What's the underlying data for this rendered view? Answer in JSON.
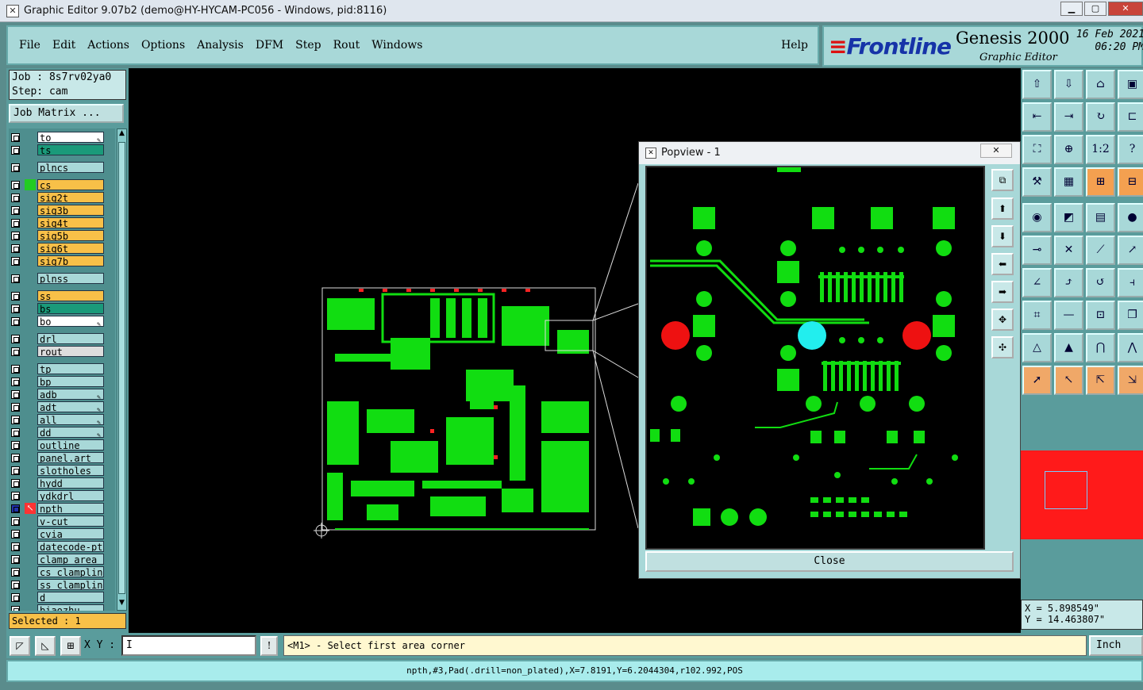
{
  "window": {
    "title": "Graphic Editor 9.07b2 (demo@HY-HYCAM-PC056 - Windows, pid:8116)"
  },
  "menu": {
    "items": [
      "File",
      "Edit",
      "Actions",
      "Options",
      "Analysis",
      "DFM",
      "Step",
      "Rout",
      "Windows"
    ],
    "help": "Help"
  },
  "brand": {
    "logo": "Frontline",
    "product": "Genesis 2000",
    "subtitle": "Graphic Editor",
    "date": "16 Feb 2021",
    "time": "06:20 PM"
  },
  "job": {
    "job_line": "Job : 8s7rv02ya0",
    "step_line": "Step: cam",
    "matrix_button": "Job Matrix ..."
  },
  "layers": [
    {
      "name": "to",
      "color": "#ffffff",
      "editable": true
    },
    {
      "name": "ts",
      "color": "#1a9a7a",
      "editable": false
    },
    {
      "name": "plncs",
      "color": "#a8d8d8",
      "editable": false
    },
    {
      "name": "cs",
      "color": "#f8c048",
      "editable": false,
      "marker": "#22cc22"
    },
    {
      "name": "sig2t",
      "color": "#f8c048",
      "editable": false
    },
    {
      "name": "sig3b",
      "color": "#f8c048",
      "editable": false
    },
    {
      "name": "sig4t",
      "color": "#f8c048",
      "editable": false
    },
    {
      "name": "sig5b",
      "color": "#f8c048",
      "editable": false
    },
    {
      "name": "sig6t",
      "color": "#f8c048",
      "editable": false
    },
    {
      "name": "sig7b",
      "color": "#f8c048",
      "editable": false
    },
    {
      "name": "plnss",
      "color": "#a8d8d8",
      "editable": false
    },
    {
      "name": "ss",
      "color": "#f8c048",
      "editable": false
    },
    {
      "name": "bs",
      "color": "#1a9a7a",
      "editable": false
    },
    {
      "name": "bo",
      "color": "#ffffff",
      "editable": true
    },
    {
      "name": "drl",
      "color": "#a8d8d8",
      "editable": false
    },
    {
      "name": "rout",
      "color": "#dddddd",
      "editable": false
    },
    {
      "name": "tp",
      "color": "#a8d8d8",
      "editable": false
    },
    {
      "name": "bp",
      "color": "#a8d8d8",
      "editable": false
    },
    {
      "name": "adb",
      "color": "#a8d8d8",
      "editable": true
    },
    {
      "name": "adt",
      "color": "#a8d8d8",
      "editable": true
    },
    {
      "name": "all",
      "color": "#a8d8d8",
      "editable": true
    },
    {
      "name": "dd",
      "color": "#a8d8d8",
      "editable": true
    },
    {
      "name": "outline",
      "color": "#a8d8d8",
      "editable": false
    },
    {
      "name": "panel.art",
      "color": "#a8d8d8",
      "editable": false
    },
    {
      "name": "slotholes",
      "color": "#a8d8d8",
      "editable": false
    },
    {
      "name": "hydd",
      "color": "#a8d8d8",
      "editable": false
    },
    {
      "name": "ydkdrl",
      "color": "#a8d8d8",
      "editable": false
    },
    {
      "name": "npth",
      "color": "#a8d8d8",
      "editable": false,
      "active": true
    },
    {
      "name": "v-cut",
      "color": "#a8d8d8",
      "editable": false
    },
    {
      "name": "cvia",
      "color": "#a8d8d8",
      "editable": false
    },
    {
      "name": "datecode-pte",
      "color": "#a8d8d8",
      "editable": false
    },
    {
      "name": "clamp_area",
      "color": "#a8d8d8",
      "editable": false
    },
    {
      "name": "cs_clampline",
      "color": "#a8d8d8",
      "editable": false
    },
    {
      "name": "ss_clampline",
      "color": "#a8d8d8",
      "editable": false
    },
    {
      "name": "d",
      "color": "#a8d8d8",
      "editable": false
    },
    {
      "name": "biaozhu",
      "color": "#a8d8d8",
      "editable": false
    }
  ],
  "selected": "Selected : 1",
  "coords": {
    "x": "X = 5.898549\"",
    "y": "Y = 14.463807\""
  },
  "xy": {
    "label": "X Y :",
    "value": "I"
  },
  "prompt": "<M1> - Select first area corner",
  "units": "Inch",
  "status": "npth,#3,Pad(.drill=non_plated),X=7.8191,Y=6.2044304,r102.992,POS",
  "popview": {
    "title": "Popview - 1",
    "close": "Close"
  }
}
